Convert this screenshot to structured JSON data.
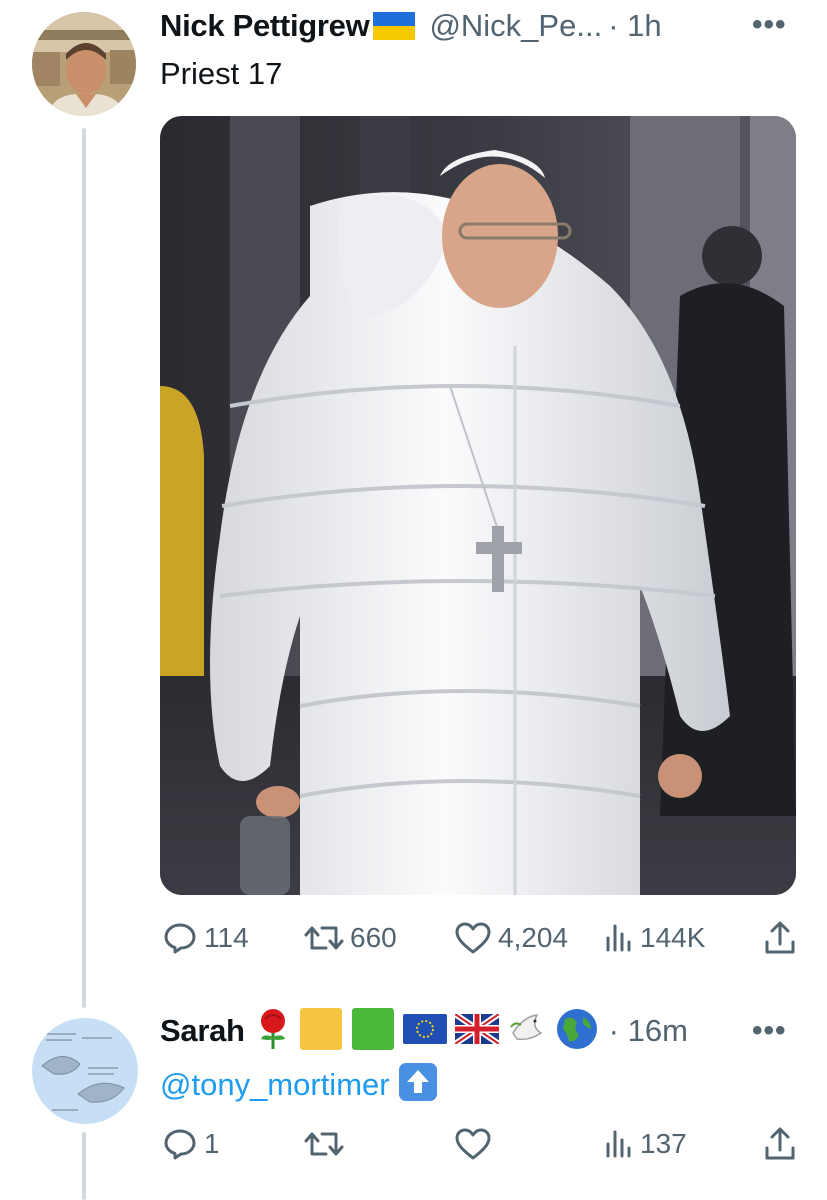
{
  "tweet1": {
    "name": "Nick Pettigrew",
    "handle": "@Nick_Pe...",
    "time": "· 1h",
    "more_label": "•••",
    "text": "Priest 17",
    "actions": {
      "replies": "114",
      "retweets": "660",
      "likes": "4,204",
      "views": "144K"
    }
  },
  "tweet2": {
    "name": "Sarah",
    "time": "· 16m",
    "more_label": "•••",
    "mention": "@tony_mortimer",
    "actions": {
      "replies": "1",
      "retweets": "",
      "likes": "",
      "views": "137"
    }
  },
  "icons": [
    "ukraine-flag-icon",
    "rose-icon",
    "yellow-square-icon",
    "green-square-icon",
    "eu-flag-icon",
    "uk-flag-icon",
    "dove-icon",
    "globe-icon",
    "up-arrow-icon",
    "reply-icon",
    "retweet-icon",
    "like-icon",
    "views-icon",
    "share-icon"
  ],
  "colors": {
    "text": "#0f1419",
    "secondary": "#536471",
    "thread_line": "#cfd9de",
    "link": "#1d9bf0"
  }
}
